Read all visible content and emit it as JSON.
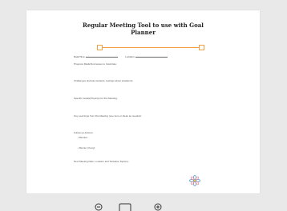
{
  "document": {
    "title_line1": "Regular Meeting Tool to use with Goal",
    "title_line2": "Planner",
    "fields": {
      "date_label": "Date/Time:",
      "location_label": "Location:"
    },
    "sections": [
      "Progress Made/Successes to Celebrate:",
      "Challenges (include students, feelings about situations):",
      "Specific Goal(s)/Topic(s) for this Meeting:",
      "Key Learnings from this Meeting (one item or ideas as needed):",
      "Follow-up Actions:",
      "Next Meeting Date, Location and Tentative Topic(s):"
    ],
    "follow_up_items": [
      "Mentee:",
      "Mentor (if any):"
    ]
  },
  "toolbar": {
    "icons": [
      "zoom-out-icon",
      "fit-page-icon",
      "zoom-in-icon"
    ]
  }
}
